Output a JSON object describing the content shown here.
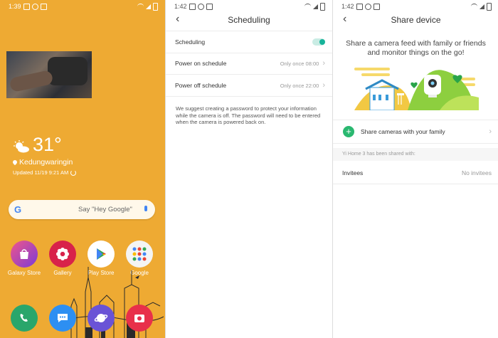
{
  "home": {
    "time": "1:39",
    "weather": {
      "temperature": "31°",
      "location": "Kedungwaringin",
      "updated": "Updated 11/19 9:21 AM"
    },
    "search": {
      "placeholder": "Say \"Hey Google\""
    },
    "apps": [
      {
        "label": "Galaxy Store",
        "color": "#e84f7c"
      },
      {
        "label": "Gallery",
        "color": "#d8224a"
      },
      {
        "label": "Play Store",
        "color": "#ffffff"
      },
      {
        "label": "Google",
        "color": "#f4f4f4"
      }
    ],
    "dock": [
      {
        "name": "phone-icon",
        "color": "#2aa66b"
      },
      {
        "name": "messages-icon",
        "color": "#2d8ff2"
      },
      {
        "name": "internet-icon",
        "color": "#6a53d6"
      },
      {
        "name": "camera-icon",
        "color": "#e8304a"
      }
    ]
  },
  "scheduling": {
    "time": "1:42",
    "title": "Scheduling",
    "rows": [
      {
        "label": "Scheduling"
      },
      {
        "label": "Power on schedule",
        "value": "Only once 08:00"
      },
      {
        "label": "Power off schedule",
        "value": "Only once 22:00"
      }
    ],
    "note": "We suggest creating a password to protect your information while the camera is off. The password will need to be entered when the camera is powered back on."
  },
  "share": {
    "time": "1:42",
    "title": "Share device",
    "headline": "Share a camera feed with family or friends and monitor things on the go!",
    "share_cameras": "Share cameras with your family",
    "shared_with": "Yi Home 3 has been shared with:",
    "invitees_label": "Invitees",
    "invitees_value": "No invitees"
  },
  "colors": {
    "home_bg": "#eeaa33",
    "toggle_accent": "#17b39a",
    "plus_green": "#2ab870"
  }
}
